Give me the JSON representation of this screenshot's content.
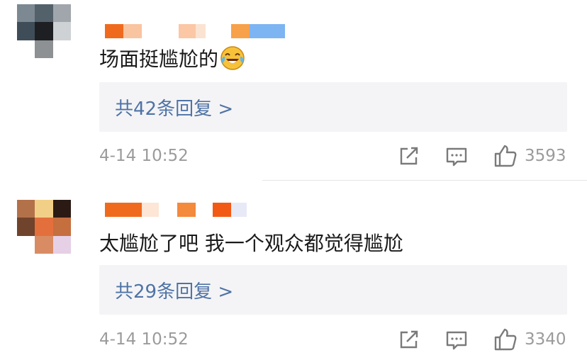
{
  "comments": [
    {
      "text": "场面挺尴尬的",
      "emoji": "tears-of-joy-emoji",
      "reply_label": "共42条回复 >",
      "time": "4-14 10:52",
      "likes": "3593",
      "username_blur_colors": [
        "#f06a1d",
        "#f9c4a0",
        "#fbc7a5",
        "#fbe3d1",
        "#f7a14a",
        "#7db5f3"
      ],
      "avatar_colors": [
        "#7c8992",
        "#53616b",
        "#a0a6ab",
        "#3f4d58",
        "#1d1f22",
        "#cfd2d4",
        "#ffffff",
        "#8d9194",
        "#ffffff"
      ]
    },
    {
      "text": "太尴尬了吧 我一个观众都觉得尴尬",
      "reply_label": "共29条回复 >",
      "time": "4-14 10:52",
      "likes": "3340",
      "username_blur_colors": [
        "#f06a1d",
        "#fde6d6",
        "#f38a3c",
        "#f25a14",
        "#e7e9f6"
      ],
      "avatar_colors": [
        "#b3714a",
        "#f2cf86",
        "#2b1a14",
        "#70432c",
        "#e36f3c",
        "#c56e3e",
        "#ffffff",
        "#d98c63",
        "#e6d0e6"
      ]
    }
  ],
  "icons": {
    "share": "share-icon",
    "comment": "comment-icon",
    "like": "thumbs-up-icon"
  }
}
